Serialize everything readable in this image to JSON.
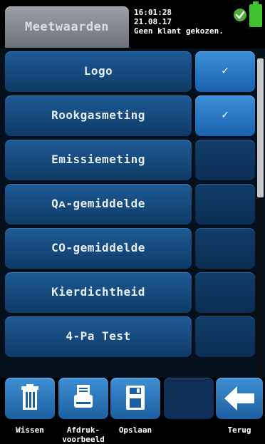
{
  "header": {
    "title": "Meetwaarden",
    "time": "16:01:28",
    "date": "21.08.17",
    "customer_status": "Geen klant gekozen.",
    "status_icon": "check-circle-icon",
    "battery_icon": "battery-icon"
  },
  "rows": [
    {
      "label": "Logo",
      "checked": true,
      "check_mark": "✓"
    },
    {
      "label": "Rookgasmeting",
      "checked": true,
      "check_mark": "✓"
    },
    {
      "label": "Emissiemeting",
      "checked": false,
      "check_mark": ""
    },
    {
      "label": "Qᴀ-gemiddelde",
      "checked": false,
      "check_mark": ""
    },
    {
      "label": "CO-gemiddelde",
      "checked": false,
      "check_mark": ""
    },
    {
      "label": "Kierdichtheid",
      "checked": false,
      "check_mark": ""
    },
    {
      "label": "4-Pa Test",
      "checked": false,
      "check_mark": ""
    }
  ],
  "toolbar": {
    "wissen": "Wissen",
    "afdruk_line1": "Afdruk-",
    "afdruk_line2": "voorbeeld",
    "opslaan": "Opslaan",
    "terug": "Terug",
    "icons": [
      "trash-icon",
      "printer-icon",
      "save-icon",
      "",
      "arrow-left-icon"
    ]
  },
  "colors": {
    "accent_blue": "#2a78c3",
    "row_blue": "#184f85",
    "status_green": "#4cae37"
  }
}
